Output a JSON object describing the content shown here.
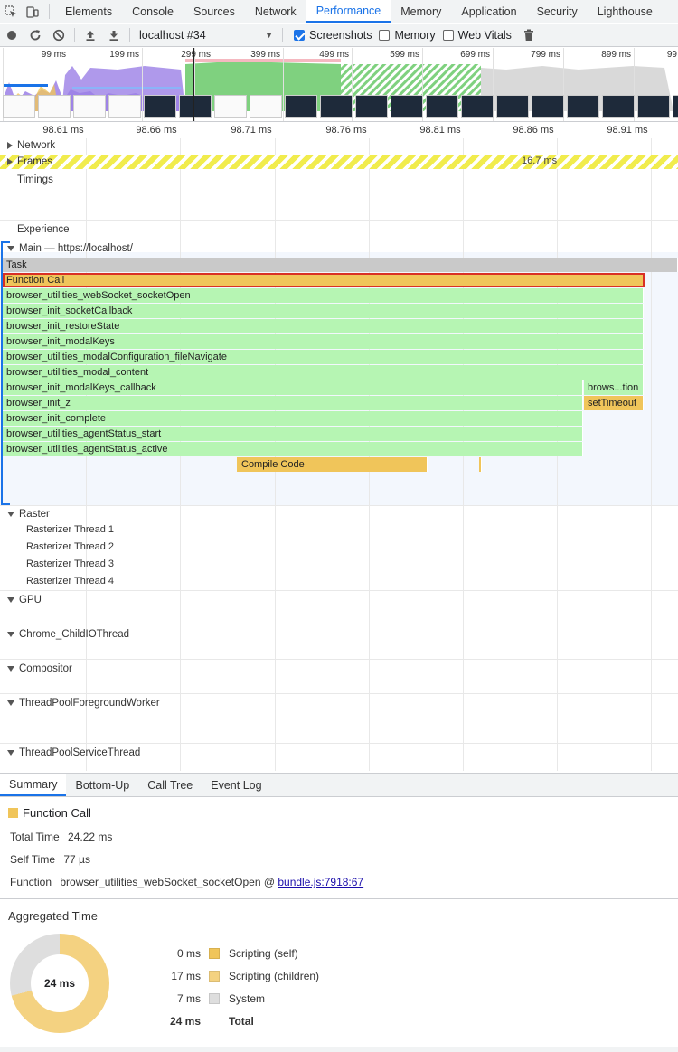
{
  "tabs": [
    "Elements",
    "Console",
    "Sources",
    "Network",
    "Performance",
    "Memory",
    "Application",
    "Security",
    "Lighthouse"
  ],
  "active_tab": "Performance",
  "toolbar": {
    "profile": "localhost #34",
    "screenshots_label": "Screenshots",
    "memory_label": "Memory",
    "webvitals_label": "Web Vitals"
  },
  "overview": {
    "ticks": [
      "99 ms",
      "199 ms",
      "299 ms",
      "399 ms",
      "499 ms",
      "599 ms",
      "699 ms",
      "799 ms",
      "899 ms",
      "99"
    ]
  },
  "ruler": [
    "98.61 ms",
    "98.66 ms",
    "98.71 ms",
    "98.76 ms",
    "98.81 ms",
    "98.86 ms",
    "98.91 ms"
  ],
  "tracks": {
    "network": "Network",
    "frames": "Frames",
    "frame_duration": "16.7 ms",
    "timings": "Timings",
    "experience": "Experience",
    "main": "Main — https://localhost/",
    "raster": "Raster",
    "raster_threads": [
      "Rasterizer Thread 1",
      "Rasterizer Thread 2",
      "Rasterizer Thread 3",
      "Rasterizer Thread 4"
    ],
    "gpu": "GPU",
    "childio": "Chrome_ChildIOThread",
    "compositor": "Compositor",
    "tpfw": "ThreadPoolForegroundWorker",
    "tpst": "ThreadPoolServiceThread"
  },
  "events": {
    "task": "Task",
    "function_call": "Function Call",
    "stack": [
      "browser_utilities_webSocket_socketOpen",
      "browser_init_socketCallback",
      "browser_init_restoreState",
      "browser_init_modalKeys",
      "browser_utilities_modalConfiguration_fileNavigate",
      "browser_utilities_modal_content",
      "browser_init_modalKeys_callback",
      "browser_init_z",
      "browser_init_complete",
      "browser_utilities_agentStatus_start",
      "browser_utilities_agentStatus_active"
    ],
    "side_1": "brows...tion",
    "side_2": "setTimeout",
    "compile": "Compile Code"
  },
  "bottom_tabs": [
    "Summary",
    "Bottom-Up",
    "Call Tree",
    "Event Log"
  ],
  "summary": {
    "title": "Function Call",
    "total_time_label": "Total Time",
    "total_time": "24.22 ms",
    "self_time_label": "Self Time",
    "self_time": "77 µs",
    "function_label": "Function",
    "function_name": "browser_utilities_webSocket_socketOpen @",
    "function_link": "bundle.js:7918:67"
  },
  "aggregated": {
    "title": "Aggregated Time",
    "center": "24 ms",
    "rows": [
      {
        "value": "0 ms",
        "label": "Scripting (self)",
        "color": "#f0c55a"
      },
      {
        "value": "17 ms",
        "label": "Scripting (children)",
        "color": "#f4d281"
      },
      {
        "value": "7 ms",
        "label": "System",
        "color": "#dedede"
      }
    ],
    "total_value": "24 ms",
    "total_label": "Total"
  },
  "colors": {
    "accent": "#1a73e8",
    "scripting": "#f0c55a",
    "user_timing": "#b6f5b3",
    "task": "#c9c9c9",
    "selection": "#d93025"
  }
}
